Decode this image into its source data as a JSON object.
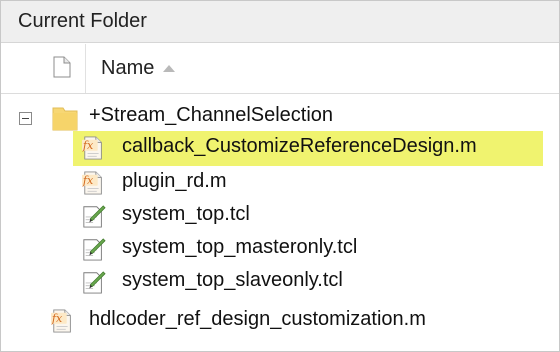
{
  "panel": {
    "title": "Current Folder"
  },
  "header": {
    "name_label": "Name",
    "sort": "ascending"
  },
  "tree": {
    "root_folder": "+Stream_ChannelSelection",
    "children": [
      {
        "label": "callback_CustomizeReferenceDesign.m",
        "icon": "function-file-icon",
        "selected": true
      },
      {
        "label": "plugin_rd.m",
        "icon": "function-file-icon",
        "selected": false
      },
      {
        "label": "system_top.tcl",
        "icon": "script-file-icon",
        "selected": false
      },
      {
        "label": "system_top_masteronly.tcl",
        "icon": "script-file-icon",
        "selected": false
      },
      {
        "label": "system_top_slaveonly.tcl",
        "icon": "script-file-icon",
        "selected": false
      }
    ],
    "bottom_file": "hdlcoder_ref_design_customization.m"
  },
  "colors": {
    "selection": "#f0f36f",
    "folder": "#f7d774",
    "function_icon": "#e8a33c"
  }
}
